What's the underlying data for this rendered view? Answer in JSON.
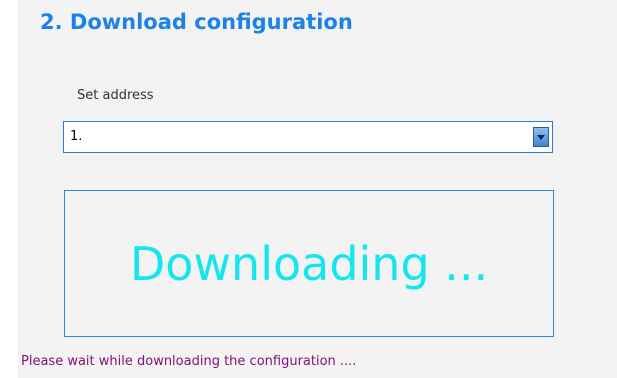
{
  "header": {
    "title": "2. Download configuration"
  },
  "address": {
    "label": "Set address",
    "selected_value": "1."
  },
  "progress": {
    "message": "Downloading ..."
  },
  "status": {
    "text": "Please wait while downloading the configuration ...."
  },
  "colors": {
    "title": "#1c82e6",
    "progress_text": "#14e6ef",
    "status_text": "#85107a",
    "border": "#2a8ad8"
  },
  "icons": {
    "dropdown": "chevron-down-icon"
  }
}
